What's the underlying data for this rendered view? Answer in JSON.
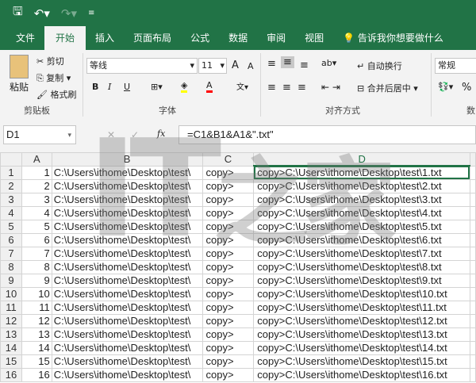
{
  "quick_access": {
    "save_icon": "save-icon",
    "undo_icon": "undo-icon",
    "redo_icon": "redo-icon",
    "customize_icon": "customize-icon"
  },
  "tabs": [
    "文件",
    "开始",
    "插入",
    "页面布局",
    "公式",
    "数据",
    "审阅",
    "视图"
  ],
  "active_tab": "开始",
  "tell_me": "告诉我你想要做什么",
  "ribbon": {
    "clipboard": {
      "paste": "粘贴",
      "cut": "剪切",
      "copy": "复制",
      "format_painter": "格式刷",
      "label": "剪贴板"
    },
    "font": {
      "name": "等线",
      "size": "11",
      "label": "字体",
      "bold": "B",
      "italic": "I",
      "underline": "U",
      "grow": "A",
      "shrink": "A",
      "font_color": "A",
      "fill_color": "#ffff00",
      "text_color": "#ff0000"
    },
    "alignment": {
      "wrap": "自动换行",
      "merge": "合并后居中",
      "label": "对齐方式"
    },
    "number": {
      "format": "常规",
      "percent": "%",
      "label": "数"
    }
  },
  "formula_bar": {
    "name_box": "D1",
    "cancel": "✕",
    "enter": "✓",
    "fx": "fx",
    "formula": "=C1&B1&A1&\".txt\""
  },
  "columns": [
    "A",
    "B",
    "C",
    "D"
  ],
  "rows": [
    {
      "n": "1",
      "a": "1",
      "b": "C:\\Users\\ithome\\Desktop\\test\\",
      "c": "copy>",
      "d": "copy>C:\\Users\\ithome\\Desktop\\test\\1.txt"
    },
    {
      "n": "2",
      "a": "2",
      "b": "C:\\Users\\ithome\\Desktop\\test\\",
      "c": "copy>",
      "d": "copy>C:\\Users\\ithome\\Desktop\\test\\2.txt"
    },
    {
      "n": "3",
      "a": "3",
      "b": "C:\\Users\\ithome\\Desktop\\test\\",
      "c": "copy>",
      "d": "copy>C:\\Users\\ithome\\Desktop\\test\\3.txt"
    },
    {
      "n": "4",
      "a": "4",
      "b": "C:\\Users\\ithome\\Desktop\\test\\",
      "c": "copy>",
      "d": "copy>C:\\Users\\ithome\\Desktop\\test\\4.txt"
    },
    {
      "n": "5",
      "a": "5",
      "b": "C:\\Users\\ithome\\Desktop\\test\\",
      "c": "copy>",
      "d": "copy>C:\\Users\\ithome\\Desktop\\test\\5.txt"
    },
    {
      "n": "6",
      "a": "6",
      "b": "C:\\Users\\ithome\\Desktop\\test\\",
      "c": "copy>",
      "d": "copy>C:\\Users\\ithome\\Desktop\\test\\6.txt"
    },
    {
      "n": "7",
      "a": "7",
      "b": "C:\\Users\\ithome\\Desktop\\test\\",
      "c": "copy>",
      "d": "copy>C:\\Users\\ithome\\Desktop\\test\\7.txt"
    },
    {
      "n": "8",
      "a": "8",
      "b": "C:\\Users\\ithome\\Desktop\\test\\",
      "c": "copy>",
      "d": "copy>C:\\Users\\ithome\\Desktop\\test\\8.txt"
    },
    {
      "n": "9",
      "a": "9",
      "b": "C:\\Users\\ithome\\Desktop\\test\\",
      "c": "copy>",
      "d": "copy>C:\\Users\\ithome\\Desktop\\test\\9.txt"
    },
    {
      "n": "10",
      "a": "10",
      "b": "C:\\Users\\ithome\\Desktop\\test\\",
      "c": "copy>",
      "d": "copy>C:\\Users\\ithome\\Desktop\\test\\10.txt"
    },
    {
      "n": "11",
      "a": "11",
      "b": "C:\\Users\\ithome\\Desktop\\test\\",
      "c": "copy>",
      "d": "copy>C:\\Users\\ithome\\Desktop\\test\\11.txt"
    },
    {
      "n": "12",
      "a": "12",
      "b": "C:\\Users\\ithome\\Desktop\\test\\",
      "c": "copy>",
      "d": "copy>C:\\Users\\ithome\\Desktop\\test\\12.txt"
    },
    {
      "n": "13",
      "a": "13",
      "b": "C:\\Users\\ithome\\Desktop\\test\\",
      "c": "copy>",
      "d": "copy>C:\\Users\\ithome\\Desktop\\test\\13.txt"
    },
    {
      "n": "14",
      "a": "14",
      "b": "C:\\Users\\ithome\\Desktop\\test\\",
      "c": "copy>",
      "d": "copy>C:\\Users\\ithome\\Desktop\\test\\14.txt"
    },
    {
      "n": "15",
      "a": "15",
      "b": "C:\\Users\\ithome\\Desktop\\test\\",
      "c": "copy>",
      "d": "copy>C:\\Users\\ithome\\Desktop\\test\\15.txt"
    },
    {
      "n": "16",
      "a": "16",
      "b": "C:\\Users\\ithome\\Desktop\\test\\",
      "c": "copy>",
      "d": "copy>C:\\Users\\ithome\\Desktop\\test\\16.txt"
    }
  ],
  "watermark": "IT之家"
}
